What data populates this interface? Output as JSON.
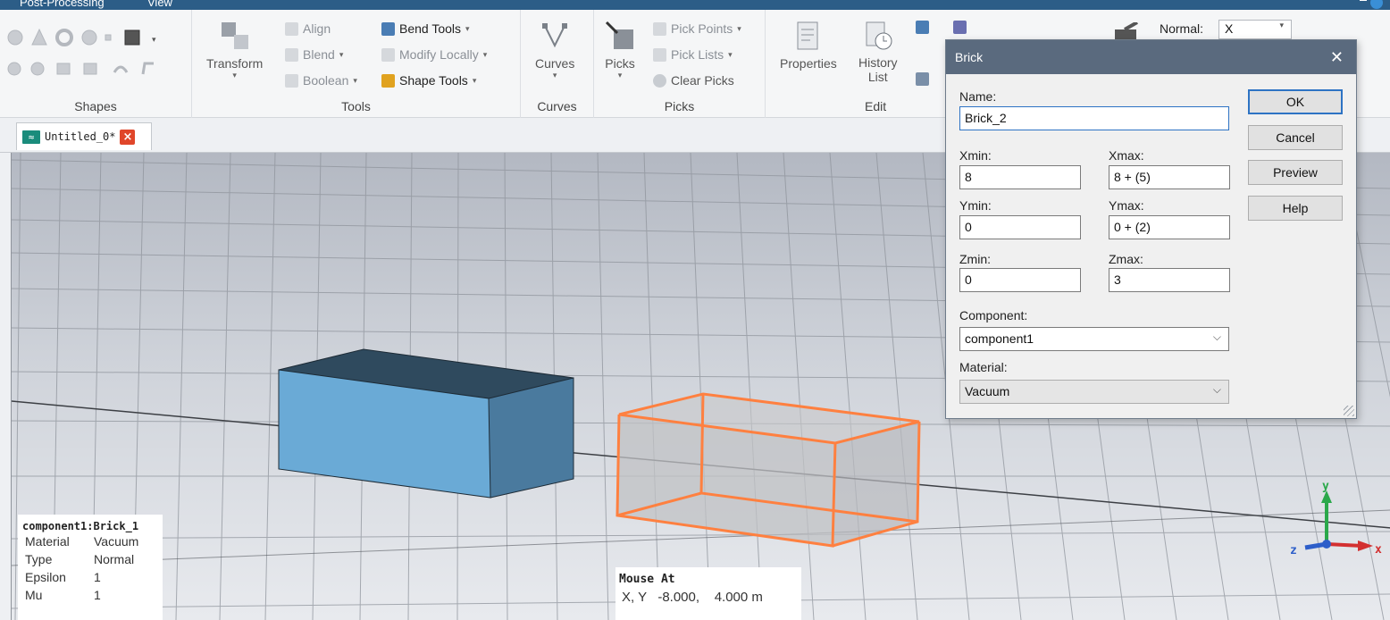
{
  "menu": {
    "items": [
      "Post-Processing",
      "View"
    ]
  },
  "ribbon": {
    "shapes": {
      "label": "Shapes"
    },
    "tools": {
      "label": "Tools",
      "transform": "Transform",
      "align": "Align",
      "blend": "Blend",
      "boolean": "Boolean",
      "bend_tools": "Bend Tools",
      "modify_locally": "Modify Locally",
      "shape_tools": "Shape Tools"
    },
    "curves": {
      "label": "Curves",
      "button": "Curves"
    },
    "picks": {
      "label": "Picks",
      "button": "Picks",
      "pick_points": "Pick Points",
      "pick_lists": "Pick Lists",
      "clear_picks": "Clear Picks"
    },
    "edit": {
      "label": "Edit",
      "properties": "Properties",
      "history_line1": "History",
      "history_line2": "List"
    },
    "normal": {
      "label": "Normal:",
      "value": "X"
    }
  },
  "document_tab": {
    "label": "Untitled_0*"
  },
  "info_box": {
    "title": "component1:Brick_1",
    "rows": [
      {
        "key": "Material",
        "value": "Vacuum"
      },
      {
        "key": "Type",
        "value": "Normal"
      },
      {
        "key": "Epsilon",
        "value": "1"
      },
      {
        "key": "Mu",
        "value": "1"
      }
    ]
  },
  "mouse": {
    "title": "Mouse At",
    "label": "X, Y",
    "value": "-8.000,    4.000 m"
  },
  "axes": {
    "x": "x",
    "y": "y",
    "z": "z"
  },
  "dialog": {
    "title": "Brick",
    "name_label": "Name:",
    "name_value": "Brick_2",
    "xmin_label": "Xmin:",
    "xmin_value": "8",
    "xmax_label": "Xmax:",
    "xmax_value": "8 + (5)",
    "ymin_label": "Ymin:",
    "ymin_value": "0",
    "ymax_label": "Ymax:",
    "ymax_value": "0 + (2)",
    "zmin_label": "Zmin:",
    "zmin_value": "0",
    "zmax_label": "Zmax:",
    "zmax_value": "3",
    "component_label": "Component:",
    "component_value": "component1",
    "material_label": "Material:",
    "material_value": "Vacuum",
    "buttons": {
      "ok": "OK",
      "cancel": "Cancel",
      "preview": "Preview",
      "help": "Help"
    }
  },
  "colors": {
    "accent": "#2d73c4",
    "brick_front": "#6aaad6",
    "brick_top": "#2f4a5e",
    "preview_outline": "#ff8040"
  }
}
